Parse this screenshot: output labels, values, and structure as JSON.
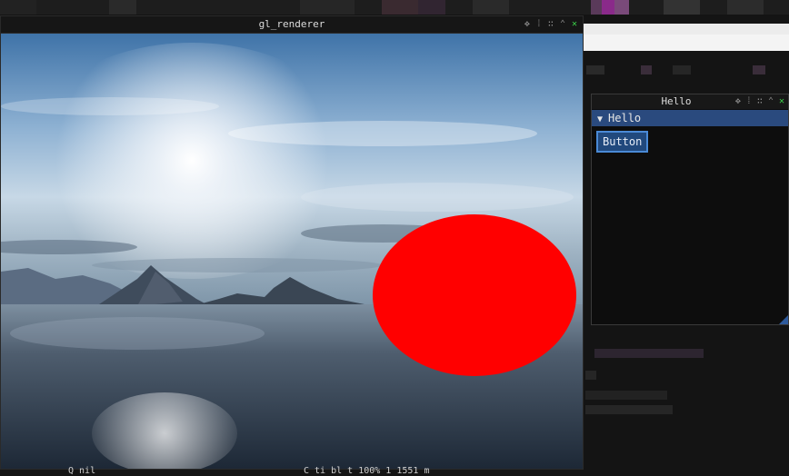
{
  "renderer_window": {
    "title": "gl_renderer",
    "controls": [
      "move-icon",
      "dock-icon",
      "grid-icon",
      "collapse-icon",
      "close-icon"
    ]
  },
  "hello_window": {
    "title": "Hello",
    "header_label": "Hello",
    "button_label": "Button"
  },
  "colors": {
    "accent": "#2a4a7e",
    "button": "#21497d",
    "button_border": "#4a8ad6",
    "red_ellipse": "#ff0000",
    "close_green": "#3cd24a"
  },
  "bottom_text": {
    "left": "Q  nil",
    "right": "C  ti  bl  t  100%  1  1551  m"
  }
}
